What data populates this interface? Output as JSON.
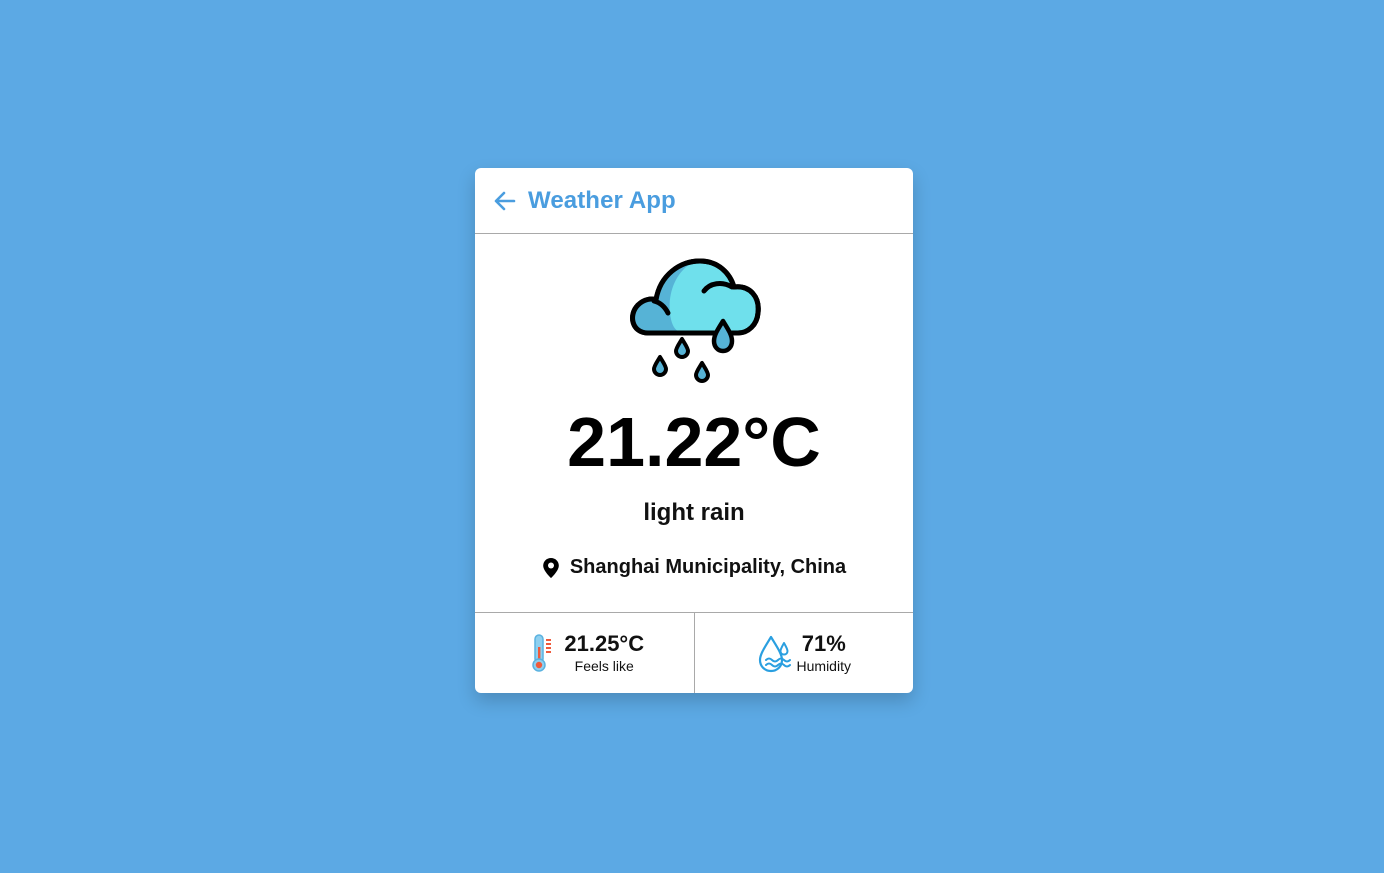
{
  "app": {
    "title": "Weather App"
  },
  "current": {
    "temperature": "21.22°C",
    "description": "light rain",
    "location": "Shanghai Municipality, China",
    "icon": "rain-cloud-icon"
  },
  "stats": {
    "feels_like": {
      "value": "21.25°C",
      "label": "Feels like",
      "icon": "thermometer-icon"
    },
    "humidity": {
      "value": "71%",
      "label": "Humidity",
      "icon": "humidity-icon"
    }
  },
  "colors": {
    "background": "#5ca9e4",
    "accent": "#4a9ddf",
    "card": "#ffffff"
  }
}
